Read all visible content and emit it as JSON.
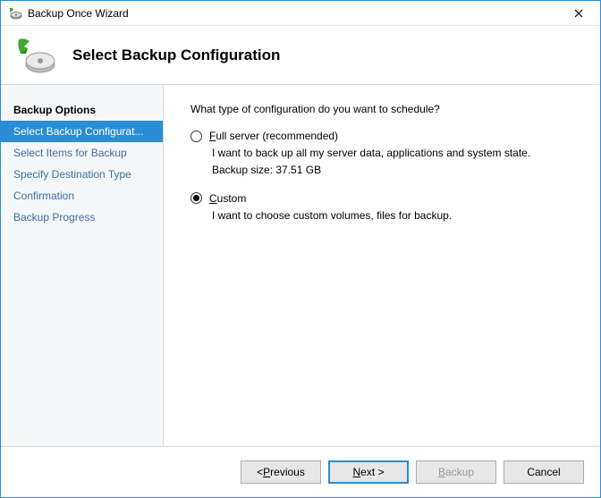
{
  "window": {
    "title": "Backup Once Wizard"
  },
  "header": {
    "title": "Select Backup Configuration"
  },
  "sidebar": {
    "items": [
      {
        "label": "Backup Options",
        "state": "bold"
      },
      {
        "label": "Select Backup Configurat...",
        "state": "selected"
      },
      {
        "label": "Select Items for Backup",
        "state": ""
      },
      {
        "label": "Specify Destination Type",
        "state": ""
      },
      {
        "label": "Confirmation",
        "state": ""
      },
      {
        "label": "Backup Progress",
        "state": ""
      }
    ]
  },
  "content": {
    "question": "What type of configuration do you want to schedule?",
    "options": [
      {
        "key": "full",
        "label_prefix": "F",
        "label_rest": "ull server (recommended)",
        "desc": "I want to back up all my server data, applications and system state.",
        "size_label": "Backup size: 37.51 GB",
        "checked": false
      },
      {
        "key": "custom",
        "label_prefix": "C",
        "label_rest": "ustom",
        "desc": "I want to choose custom volumes, files for backup.",
        "size_label": "",
        "checked": true
      }
    ]
  },
  "footer": {
    "previous_prefix": "< ",
    "previous_u": "P",
    "previous_rest": "revious",
    "next_u": "N",
    "next_rest": "ext >",
    "backup_u": "B",
    "backup_rest": "ackup",
    "cancel": "Cancel"
  }
}
